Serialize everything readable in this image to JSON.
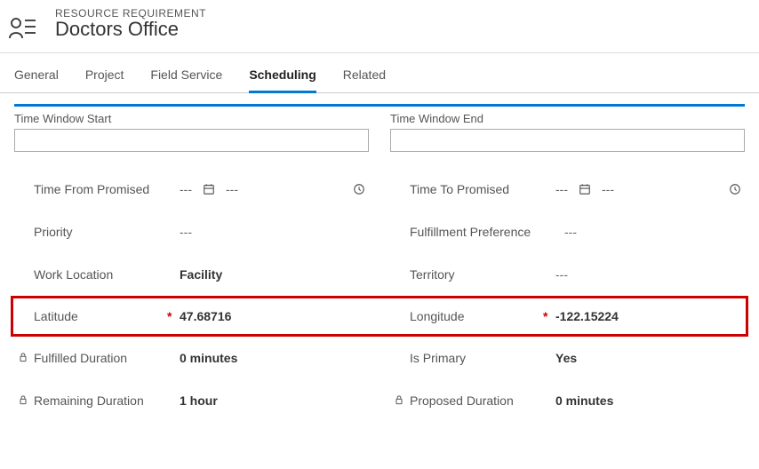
{
  "header": {
    "entity_type": "RESOURCE REQUIREMENT",
    "title": "Doctors Office"
  },
  "tabs": [
    {
      "label": "General"
    },
    {
      "label": "Project"
    },
    {
      "label": "Field Service"
    },
    {
      "label": "Scheduling",
      "active": true
    },
    {
      "label": "Related"
    }
  ],
  "left": {
    "section_label": "Time Window Start",
    "section_value": "",
    "fields": {
      "time_from_promised": {
        "label": "Time From Promised",
        "date": "---",
        "time": "---"
      },
      "priority": {
        "label": "Priority",
        "value": "---"
      },
      "work_location": {
        "label": "Work Location",
        "value": "Facility"
      },
      "latitude": {
        "label": "Latitude",
        "value": "47.68716",
        "required": true
      },
      "fulfilled_duration": {
        "label": "Fulfilled Duration",
        "value": "0 minutes",
        "locked": true
      },
      "remaining_duration": {
        "label": "Remaining Duration",
        "value": "1 hour",
        "locked": true
      }
    }
  },
  "right": {
    "section_label": "Time Window End",
    "section_value": "",
    "fields": {
      "time_to_promised": {
        "label": "Time To Promised",
        "date": "---",
        "time": "---"
      },
      "fulfillment_preference": {
        "label": "Fulfillment Preference",
        "value": "---"
      },
      "territory": {
        "label": "Territory",
        "value": "---"
      },
      "longitude": {
        "label": "Longitude",
        "value": "-122.15224",
        "required": true
      },
      "is_primary": {
        "label": "Is Primary",
        "value": "Yes"
      },
      "proposed_duration": {
        "label": "Proposed Duration",
        "value": "0 minutes",
        "locked": true
      }
    }
  },
  "sym": {
    "required": "*",
    "dashes": "---"
  }
}
